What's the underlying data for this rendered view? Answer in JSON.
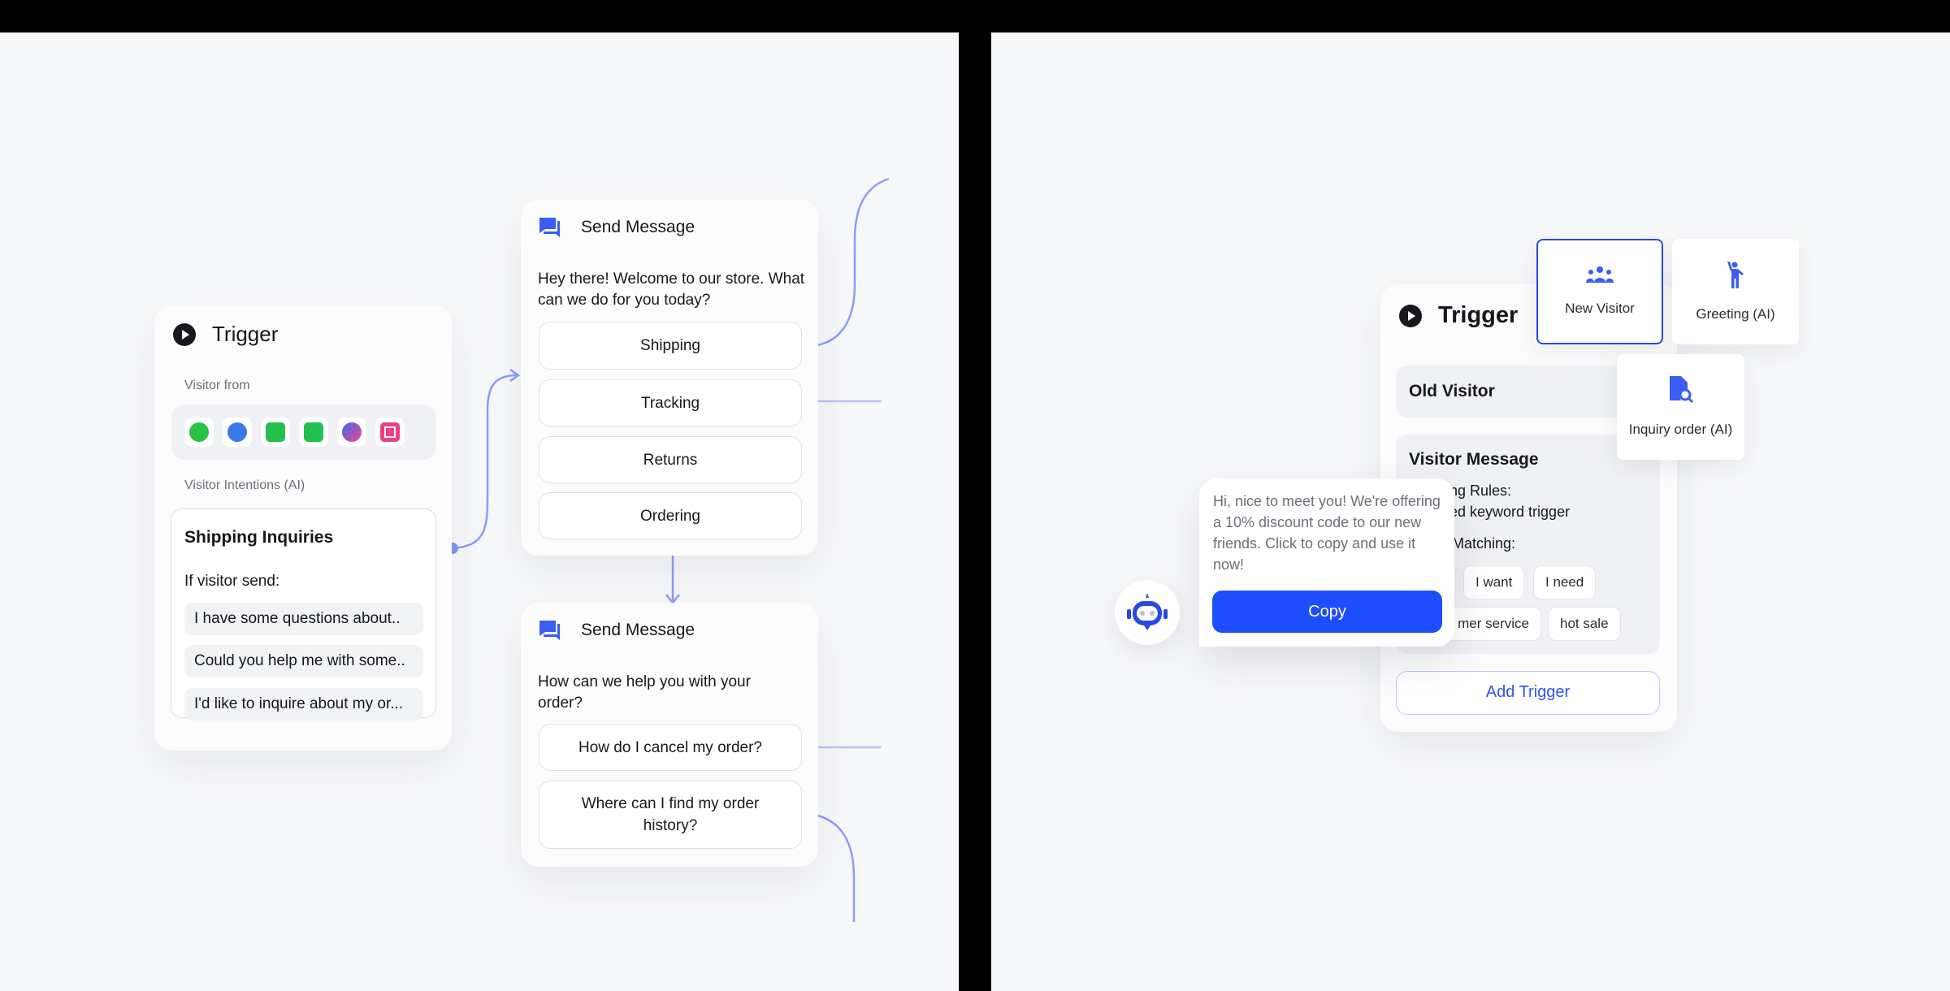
{
  "left": {
    "trigger": {
      "title": "Trigger",
      "visitor_from_label": "Visitor from",
      "channels": [
        "whatsapp-icon",
        "telegram-icon",
        "wechat-icon",
        "line-icon",
        "messenger-icon",
        "instagram-icon"
      ],
      "intentions_label": "Visitor Intentions (AI)",
      "intention": {
        "title": "Shipping Inquiries",
        "if_label": "If visitor send:",
        "examples": [
          "I have some questions about..",
          "Could you help me with some..",
          "I'd like to inquire about my or..."
        ]
      }
    },
    "send_message_1": {
      "title": "Send Message",
      "text": "Hey there! Welcome to our store. What can we do for you today?",
      "buttons": [
        "Shipping",
        "Tracking",
        "Returns",
        "Ordering"
      ]
    },
    "send_message_2": {
      "title": "Send Message",
      "text": "How can we help you with your order?",
      "buttons": [
        "How do I cancel my order?",
        "Where can I find my order history?"
      ]
    }
  },
  "right": {
    "trigger": {
      "title": "Trigger",
      "old_visitor": "Old Visitor",
      "visitor_message": {
        "title": "Visitor Message",
        "line1": "ing Rules:",
        "line2": "ied keyword trigger",
        "line3": "Matching:",
        "chips": [
          "I want",
          "I need",
          "mer service",
          "hot sale"
        ]
      },
      "add_trigger": "Add Trigger"
    },
    "tiles": {
      "new_visitor": "New Visitor",
      "greeting": "Greeting (AI)",
      "inquiry": "Inquiry order (AI)"
    },
    "popup": {
      "text": "Hi, nice to meet you! We're offering a 10% discount code to our new friends. Click to copy and use it now!",
      "copy": "Copy"
    }
  },
  "colors": {
    "accent": "#1e4dfb",
    "connector": "#7f95fb",
    "tile_selected_border": "#2749e8"
  }
}
